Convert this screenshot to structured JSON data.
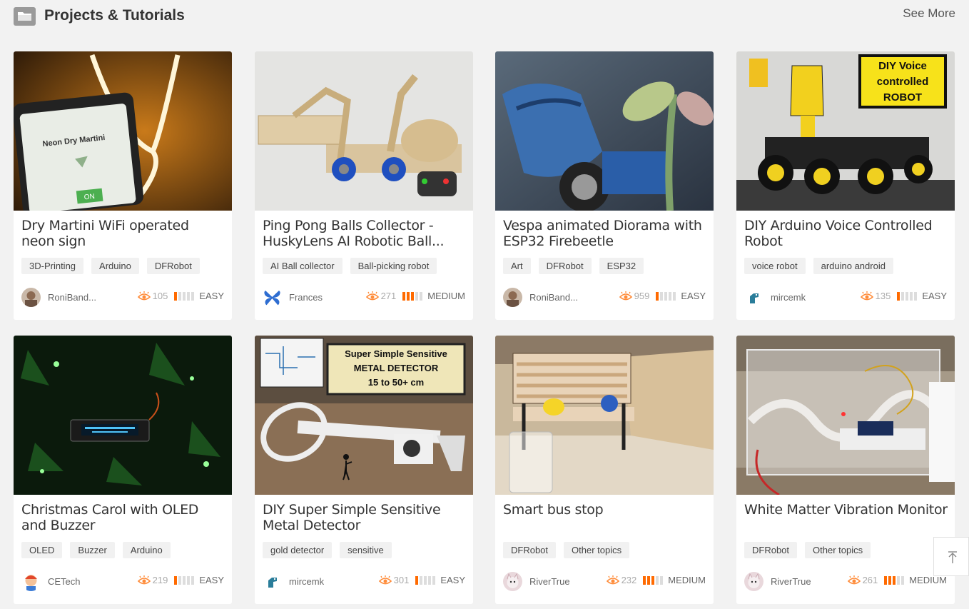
{
  "header": {
    "title": "Projects & Tutorials",
    "see_more": "See More"
  },
  "colors": {
    "accent": "#ff6a00",
    "tag_bg": "#f1f1f1"
  },
  "cards": [
    {
      "title": "Dry Martini WiFi operated neon sign",
      "tags": [
        "3D-Printing",
        "Arduino",
        "DFRobot"
      ],
      "author": "RoniBand...",
      "views": "105",
      "level": "EASY",
      "level_bars": 1,
      "image": "neon-sign-photo",
      "avatar": "person-avatar"
    },
    {
      "title": "Ping Pong Balls Collector - HuskyLens AI Robotic Ball...",
      "tags": [
        "AI Ball collector",
        "Ball-picking robot"
      ],
      "author": "Frances",
      "views": "271",
      "level": "MEDIUM",
      "level_bars": 3,
      "image": "wooden-robot-photo",
      "avatar": "butterfly-avatar"
    },
    {
      "title": "Vespa animated Diorama with ESP32 Firebeetle",
      "tags": [
        "Art",
        "DFRobot",
        "ESP32"
      ],
      "author": "RoniBand...",
      "views": "959",
      "level": "EASY",
      "level_bars": 1,
      "image": "vespa-diorama-photo",
      "avatar": "person-avatar"
    },
    {
      "title": "DIY Arduino Voice Controlled Robot",
      "tags": [
        "voice robot",
        "arduino android"
      ],
      "author": "mircemk",
      "views": "135",
      "level": "EASY",
      "level_bars": 1,
      "image": "voice-robot-photo",
      "avatar": "dino-avatar"
    },
    {
      "title": "Christmas Carol with OLED and Buzzer",
      "tags": [
        "OLED",
        "Buzzer",
        "Arduino"
      ],
      "author": "CETech",
      "views": "219",
      "level": "EASY",
      "level_bars": 1,
      "image": "christmas-tree-photo",
      "avatar": "cartoon-avatar"
    },
    {
      "title": "DIY Super Simple Sensitive Metal Detector",
      "tags": [
        "gold detector",
        "sensitive"
      ],
      "author": "mircemk",
      "views": "301",
      "level": "EASY",
      "level_bars": 1,
      "image": "metal-detector-photo",
      "avatar": "dino-avatar"
    },
    {
      "title": "Smart bus stop",
      "tags": [
        "DFRobot",
        "Other topics"
      ],
      "author": "RiverTrue",
      "views": "232",
      "level": "MEDIUM",
      "level_bars": 3,
      "image": "bus-stop-photo",
      "avatar": "cat-avatar"
    },
    {
      "title": "White Matter Vibration Monitor",
      "tags": [
        "DFRobot",
        "Other topics"
      ],
      "author": "RiverTrue",
      "views": "261",
      "level": "MEDIUM",
      "level_bars": 3,
      "image": "vibration-monitor-photo",
      "avatar": "cat-avatar"
    }
  ],
  "thumb_text": {
    "neon_app_title": "Neon Dry Martini",
    "neon_app_button": "ON",
    "voice_sign": [
      "DIY Voice",
      "controlled",
      "ROBOT"
    ],
    "metal_sign": [
      "Super Simple Sensitive",
      "METAL DETECTOR",
      "15 to 50+ cm"
    ]
  }
}
